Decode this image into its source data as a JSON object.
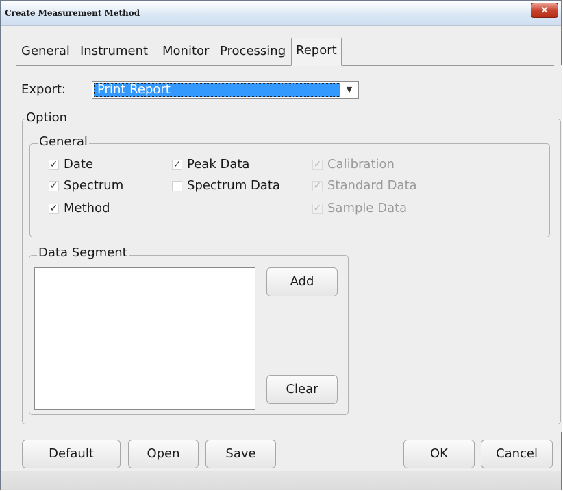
{
  "window": {
    "title": "Create Measurement Method",
    "close_label": "×"
  },
  "tabs": [
    {
      "label": "General",
      "active": false
    },
    {
      "label": "Instrument",
      "active": false
    },
    {
      "label": "Monitor",
      "active": false
    },
    {
      "label": "Processing",
      "active": false
    },
    {
      "label": "Report",
      "active": true
    }
  ],
  "export": {
    "label": "Export:",
    "selected": "Print Report"
  },
  "option": {
    "legend": "Option",
    "general": {
      "legend": "General",
      "checkboxes": [
        {
          "label": "Date",
          "checked": true,
          "enabled": true
        },
        {
          "label": "Peak Data",
          "checked": true,
          "enabled": true
        },
        {
          "label": "Calibration",
          "checked": true,
          "enabled": false
        },
        {
          "label": "Spectrum",
          "checked": true,
          "enabled": true
        },
        {
          "label": "Spectrum Data",
          "checked": false,
          "enabled": true
        },
        {
          "label": "Standard Data",
          "checked": true,
          "enabled": false
        },
        {
          "label": "Method",
          "checked": true,
          "enabled": true
        },
        {
          "label": "Sample Data",
          "checked": true,
          "enabled": false
        }
      ]
    },
    "data_segment": {
      "legend": "Data Segment",
      "add_label": "Add",
      "clear_label": "Clear"
    }
  },
  "buttons": {
    "default": "Default",
    "open": "Open",
    "save": "Save",
    "ok": "OK",
    "cancel": "Cancel"
  },
  "colors": {
    "selection": "#3399ff",
    "close_button": "#c7432d",
    "disabled_text": "#9a9a9a"
  },
  "icons": {
    "checkmark": "✓",
    "dropdown": "▼"
  }
}
